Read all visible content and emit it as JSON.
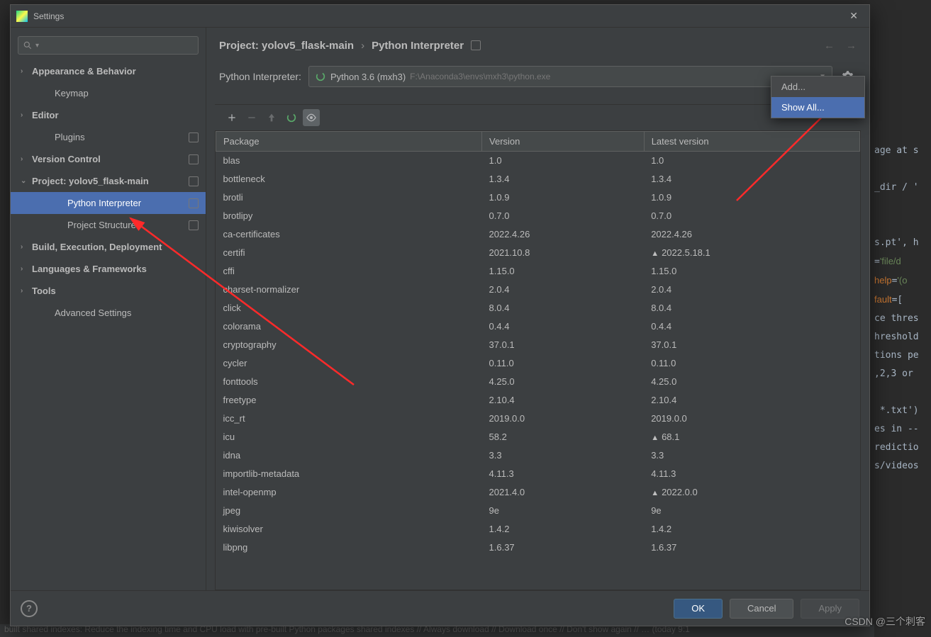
{
  "window": {
    "title": "Settings"
  },
  "search": {
    "placeholder": ""
  },
  "sidebar": [
    {
      "label": "Appearance & Behavior",
      "arrow": "›",
      "bold": true
    },
    {
      "label": "Keymap",
      "arrow": "",
      "bold": true,
      "sub": true
    },
    {
      "label": "Editor",
      "arrow": "›",
      "bold": true
    },
    {
      "label": "Plugins",
      "arrow": "",
      "bold": true,
      "sub": true,
      "badge": true
    },
    {
      "label": "Version Control",
      "arrow": "›",
      "bold": true,
      "badge": true
    },
    {
      "label": "Project: yolov5_flask-main",
      "arrow": "⌄",
      "bold": true,
      "badge": true
    },
    {
      "label": "Python Interpreter",
      "arrow": "",
      "sub2": true,
      "selected": true,
      "badge": true
    },
    {
      "label": "Project Structure",
      "arrow": "",
      "sub2": true,
      "badge": true
    },
    {
      "label": "Build, Execution, Deployment",
      "arrow": "›",
      "bold": true
    },
    {
      "label": "Languages & Frameworks",
      "arrow": "›",
      "bold": true
    },
    {
      "label": "Tools",
      "arrow": "›",
      "bold": true
    },
    {
      "label": "Advanced Settings",
      "arrow": "",
      "bold": true,
      "sub": true
    }
  ],
  "crumbs": {
    "a": "Project: yolov5_flask-main",
    "b": "Python Interpreter"
  },
  "interpreter": {
    "label": "Python Interpreter:",
    "name": "Python 3.6 (mxh3)",
    "path": "F:\\Anaconda3\\envs\\mxh3\\python.exe"
  },
  "columns": [
    "Package",
    "Version",
    "Latest version"
  ],
  "packages": [
    {
      "name": "blas",
      "version": "1.0",
      "latest": "1.0"
    },
    {
      "name": "bottleneck",
      "version": "1.3.4",
      "latest": "1.3.4"
    },
    {
      "name": "brotli",
      "version": "1.0.9",
      "latest": "1.0.9"
    },
    {
      "name": "brotlipy",
      "version": "0.7.0",
      "latest": "0.7.0"
    },
    {
      "name": "ca-certificates",
      "version": "2022.4.26",
      "latest": "2022.4.26"
    },
    {
      "name": "certifi",
      "version": "2021.10.8",
      "latest": "2022.5.18.1",
      "up": true
    },
    {
      "name": "cffi",
      "version": "1.15.0",
      "latest": "1.15.0"
    },
    {
      "name": "charset-normalizer",
      "version": "2.0.4",
      "latest": "2.0.4"
    },
    {
      "name": "click",
      "version": "8.0.4",
      "latest": "8.0.4"
    },
    {
      "name": "colorama",
      "version": "0.4.4",
      "latest": "0.4.4"
    },
    {
      "name": "cryptography",
      "version": "37.0.1",
      "latest": "37.0.1"
    },
    {
      "name": "cycler",
      "version": "0.11.0",
      "latest": "0.11.0"
    },
    {
      "name": "fonttools",
      "version": "4.25.0",
      "latest": "4.25.0"
    },
    {
      "name": "freetype",
      "version": "2.10.4",
      "latest": "2.10.4"
    },
    {
      "name": "icc_rt",
      "version": "2019.0.0",
      "latest": "2019.0.0"
    },
    {
      "name": "icu",
      "version": "58.2",
      "latest": "68.1",
      "up": true
    },
    {
      "name": "idna",
      "version": "3.3",
      "latest": "3.3"
    },
    {
      "name": "importlib-metadata",
      "version": "4.11.3",
      "latest": "4.11.3"
    },
    {
      "name": "intel-openmp",
      "version": "2021.4.0",
      "latest": "2022.0.0",
      "up": true
    },
    {
      "name": "jpeg",
      "version": "9e",
      "latest": "9e"
    },
    {
      "name": "kiwisolver",
      "version": "1.4.2",
      "latest": "1.4.2"
    },
    {
      "name": "libpng",
      "version": "1.6.37",
      "latest": "1.6.37"
    }
  ],
  "popup": {
    "add": "Add...",
    "showall": "Show All..."
  },
  "buttons": {
    "ok": "OK",
    "cancel": "Cancel",
    "apply": "Apply"
  },
  "statusbar": "built shared indexes: Reduce the indexing time and CPU load with pre-built Python packages shared indexes // Always download // Download once // Don't show again // … (today 9:1",
  "watermark": "CSDN @三个刺客"
}
